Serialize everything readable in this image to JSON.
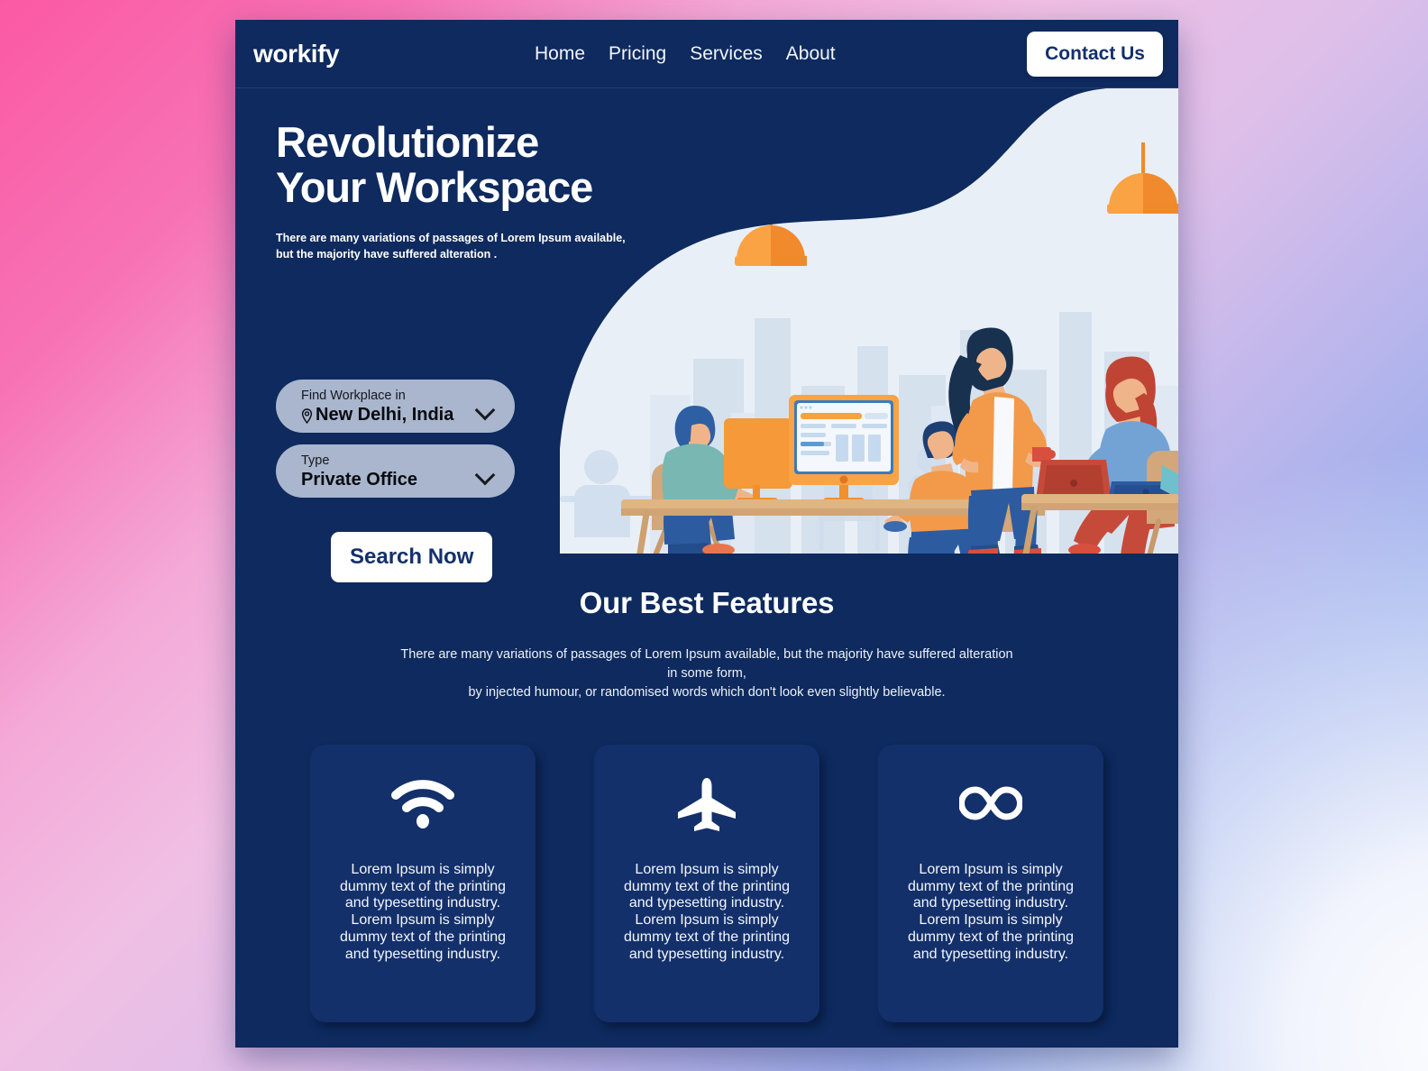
{
  "brand": {
    "logo": "workify",
    "accent_dark": "#0e2a5e",
    "card_bg": "#13306b",
    "orange": "#f5983c"
  },
  "header": {
    "nav": [
      {
        "label": "Home"
      },
      {
        "label": "Pricing"
      },
      {
        "label": "Services"
      },
      {
        "label": "About"
      }
    ],
    "cta": "Contact Us"
  },
  "hero": {
    "title": "Revolutionize\nYour Workspace",
    "subtitle": "There are many variations of passages of Lorem Ipsum available,\n but the majority have suffered alteration .",
    "fields": [
      {
        "label": "Find Workplace in",
        "value": "New Delhi, India",
        "icon": "location-pin-icon"
      },
      {
        "label": "Type",
        "value": "Private Office",
        "icon": "none"
      }
    ],
    "search_button": "Search Now",
    "illustration": "coworking-office-illustration"
  },
  "features": {
    "title": "Our Best Features",
    "subtitle": "There are many variations of passages of Lorem Ipsum available, but the majority have suffered alteration in some form,\nby injected humour, or randomised words which don't look even slightly believable.",
    "cards": [
      {
        "icon": "wifi-icon",
        "text": "Lorem Ipsum is simply dummy text of the printing and typesetting industry. Lorem Ipsum is simply dummy text of the printing and typesetting industry."
      },
      {
        "icon": "airplane-icon",
        "text": "Lorem Ipsum is simply dummy text of the printing and typesetting industry. Lorem Ipsum is simply dummy text of the printing and typesetting industry."
      },
      {
        "icon": "infinity-icon",
        "text": "Lorem Ipsum is simply dummy text of the printing and typesetting industry. Lorem Ipsum is simply dummy text of the printing and typesetting industry."
      }
    ]
  }
}
